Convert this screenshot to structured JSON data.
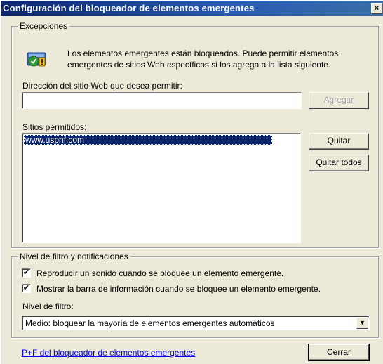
{
  "window": {
    "title": "Configuración del bloqueador de elementos emergentes",
    "close_symbol": "×"
  },
  "exceptions": {
    "group_label": "Excepciones",
    "icon": "shield-warning-icon",
    "info_line1": "Los elementos emergentes están bloqueados.  Puede permitir elementos",
    "info_line2": "emergentes de sitios Web específicos si los agrega a la lista siguiente.",
    "address_label": "Dirección del sitio Web que desea permitir:",
    "address_value": "",
    "add_button": "Agregar",
    "allowed_label": "Sitios permitidos:",
    "allowed_sites": [
      "www.uspnf.com"
    ],
    "remove_button": "Quitar",
    "remove_all_button": "Quitar todos"
  },
  "filter": {
    "group_label": "Nivel de filtro y notificaciones",
    "play_sound_label": "Reproducir un sonido cuando se bloquee un elemento emergente.",
    "play_sound_checked": "✔",
    "show_bar_label": "Mostrar la barra de información cuando se bloquee un elemento emergente.",
    "show_bar_checked": "✔",
    "level_label": "Nivel de filtro:",
    "level_value": "Medio: bloquear la mayoría de elementos emergentes automáticos",
    "dropdown_arrow": "▼"
  },
  "footer": {
    "help_link": "P+F del bloqueador de elementos emergentes",
    "close_button": "Cerrar"
  },
  "colors": {
    "titlebar": "#0a246a",
    "face": "#ece9d8",
    "selection": "#0a246a",
    "link": "#0000ff"
  }
}
